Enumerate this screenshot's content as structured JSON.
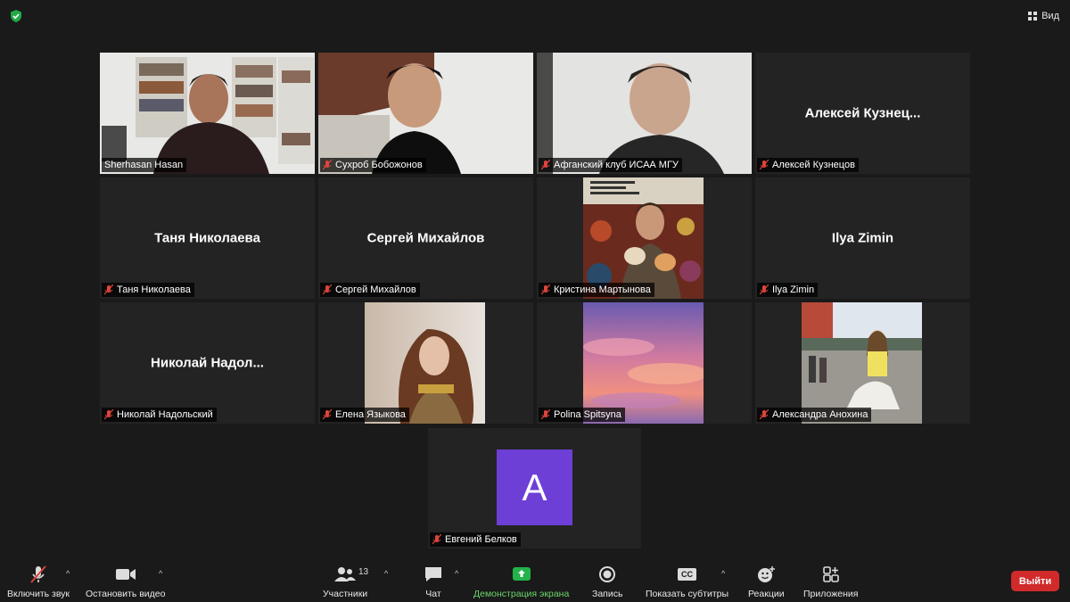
{
  "top": {
    "view_label": "Вид"
  },
  "participants": [
    {
      "name": "Sherhasan Hasan",
      "video": true,
      "muted": false,
      "active": true,
      "photo": "man-bookshelf"
    },
    {
      "name": "Сухроб Бобожонов",
      "video": true,
      "muted": true,
      "photo": "young-man-white-wall"
    },
    {
      "name": "Афганский клуб ИСАА МГУ",
      "video": true,
      "muted": true,
      "photo": "young-man-grey-wall"
    },
    {
      "name": "Алексей Кузнецов",
      "display": "Алексей  Кузнец...",
      "video": false,
      "muted": true
    },
    {
      "name": "Таня Николаева",
      "display": "Таня Николаева",
      "video": false,
      "muted": true
    },
    {
      "name": "Сергей Михайлов",
      "display": "Сергей Михайлов",
      "video": false,
      "muted": true
    },
    {
      "name": "Кристина Мартынова",
      "video": false,
      "muted": true,
      "photo": "man-with-cats-poster"
    },
    {
      "name": "Ilya Zimin",
      "display": "Ilya Zimin",
      "video": false,
      "muted": true
    },
    {
      "name": "Николай Надольский",
      "display": "Николай  Надол...",
      "video": false,
      "muted": true
    },
    {
      "name": "Елена Языкова",
      "video": false,
      "muted": true,
      "photo": "woman-street"
    },
    {
      "name": "Polina Spitsyna",
      "video": false,
      "muted": true,
      "photo": "pink-sky"
    },
    {
      "name": "Александра Анохина",
      "video": false,
      "muted": true,
      "photo": "woman-sitting-city"
    }
  ],
  "last_participant": {
    "name": "Евгений Белков",
    "avatar_letter": "A",
    "avatar_color": "#6d3fd6",
    "muted": true
  },
  "toolbar": {
    "unmute": "Включить звук",
    "stop_video": "Остановить видео",
    "participants": "Участники",
    "participants_count": "13",
    "chat": "Чат",
    "share_screen": "Демонстрация экрана",
    "record": "Запись",
    "captions": "Показать субтитры",
    "captions_icon_text": "CC",
    "reactions": "Реакции",
    "apps": "Приложения",
    "leave": "Выйти"
  },
  "colors": {
    "active_border": "#d5f06a",
    "leave": "#d12a2a",
    "share_green": "#24b24b",
    "muted_icon": "#e0443b"
  }
}
